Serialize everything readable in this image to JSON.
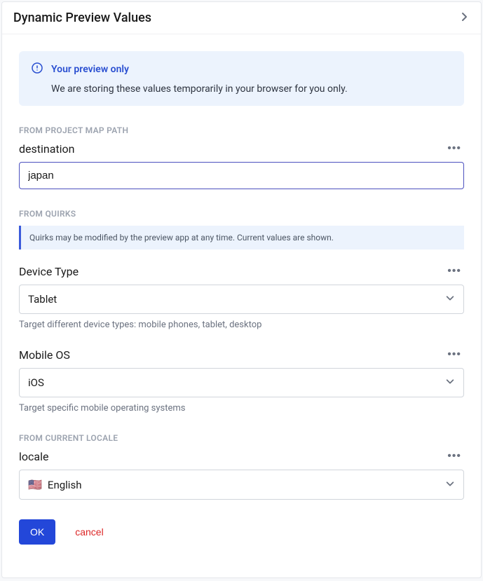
{
  "panel": {
    "title": "Dynamic Preview Values"
  },
  "info": {
    "title": "Your preview only",
    "text": "We are storing these values temporarily in your browser for you only."
  },
  "mapPath": {
    "heading": "FROM PROJECT MAP PATH",
    "label": "destination",
    "value": "japan"
  },
  "quirks": {
    "heading": "FROM QUIRKS",
    "note": "Quirks may be modified by the preview app at any time. Current values are shown.",
    "deviceType": {
      "label": "Device Type",
      "value": "Tablet",
      "helper": "Target different device types: mobile phones, tablet, desktop"
    },
    "mobileOS": {
      "label": "Mobile OS",
      "value": "iOS",
      "helper": "Target specific mobile operating systems"
    }
  },
  "locale": {
    "heading": "FROM CURRENT LOCALE",
    "label": "locale",
    "value": "English",
    "flag": "🇺🇸"
  },
  "actions": {
    "ok": "OK",
    "cancel": "cancel"
  }
}
